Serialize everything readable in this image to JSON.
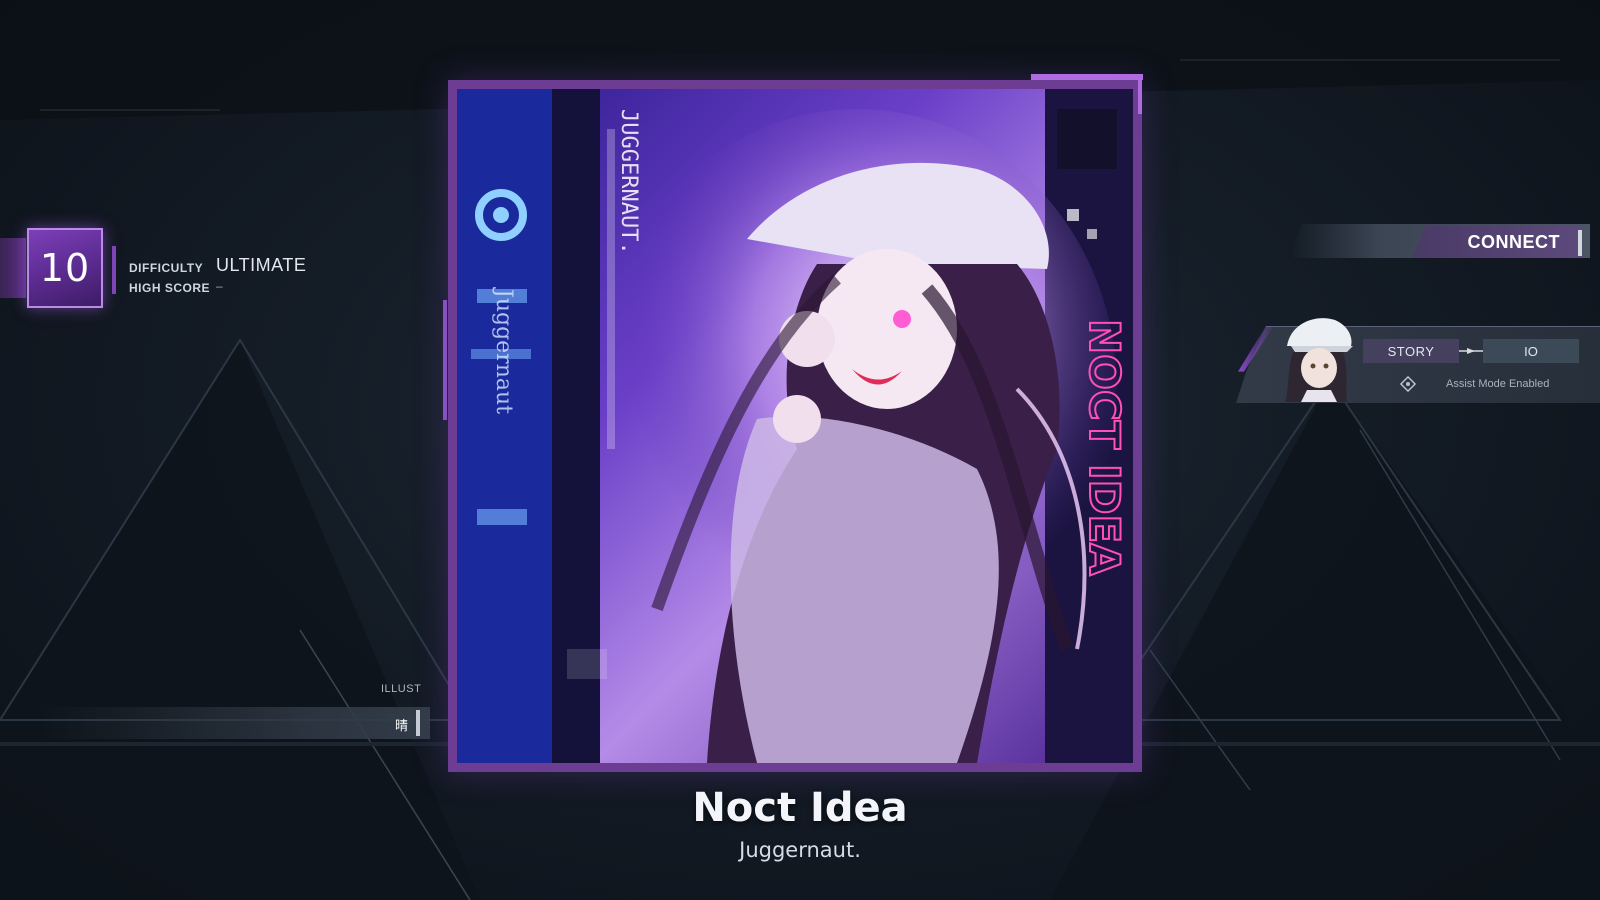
{
  "difficulty": {
    "level": "10",
    "difficulty_label": "DIFFICULTY",
    "difficulty_value": "ULTIMATE",
    "high_score_label": "HIGH SCORE",
    "high_score_value": "–"
  },
  "illust": {
    "label": "ILLUST",
    "artist": "晴"
  },
  "song": {
    "title": "Noct Idea",
    "artist": "Juggernaut."
  },
  "jacket": {
    "side_text": "NOCT IDEA",
    "vertical_text": "JUGGERNAUT.",
    "brand_text": "Juggernaut"
  },
  "connect": {
    "label": "CONNECT"
  },
  "story": {
    "story_label": "STORY",
    "mode_value": "IO",
    "assist_text": "Assist Mode Enabled"
  },
  "colors": {
    "accent": "#8e4fd0",
    "frame": "#6c3d92",
    "background": "#141c26"
  }
}
